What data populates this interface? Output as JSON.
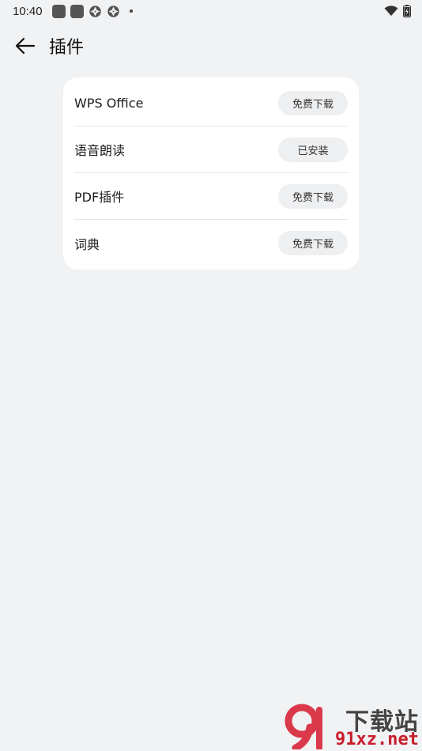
{
  "status_bar": {
    "time": "10:40",
    "icons": [
      "app-square-icon",
      "app-square-icon",
      "aperture-icon",
      "aperture-icon",
      "dot-icon"
    ],
    "right_icons": [
      "wifi-icon",
      "battery-icon"
    ]
  },
  "header": {
    "title": "插件",
    "back_icon": "back-arrow-icon"
  },
  "plugins": [
    {
      "name": "WPS Office",
      "action": "免费下载"
    },
    {
      "name": "语音朗读",
      "action": "已安装"
    },
    {
      "name": "PDF插件",
      "action": "免费下载"
    },
    {
      "name": "词典",
      "action": "免费下载"
    }
  ],
  "watermark": {
    "brand": "下载站",
    "domain": "91xz.net"
  }
}
